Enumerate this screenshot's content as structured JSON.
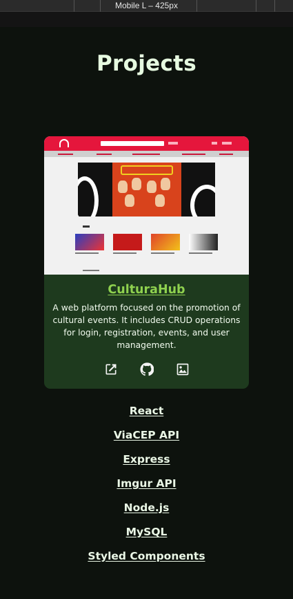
{
  "devtools": {
    "device_label": "Mobile L – 425px"
  },
  "page": {
    "title": "Projects"
  },
  "project": {
    "name": "CulturaHub",
    "description": "A web platform focused on the promotion of cultural events. It includes CRUD operations for login, registration, events, and user management.",
    "icons": [
      "external-link-icon",
      "github-icon",
      "image-icon"
    ],
    "technologies": [
      "React",
      "ViaCEP API",
      "Express",
      "Imgur API",
      "Node.js",
      "MySQL",
      "Styled Components"
    ]
  },
  "colors": {
    "background": "#0d120d",
    "card": "#1e3a1e",
    "project_name": "#8fd14f",
    "screenshot_nav": "#e5163c"
  }
}
